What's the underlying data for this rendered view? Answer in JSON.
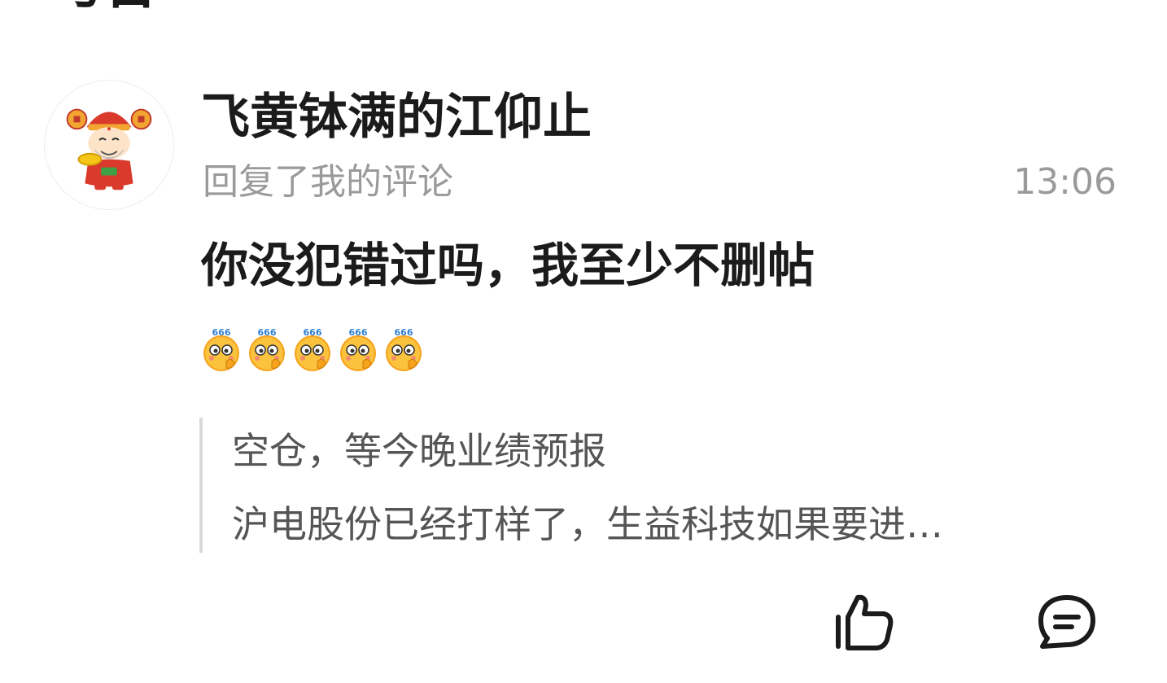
{
  "header": {
    "title": "与台"
  },
  "comment": {
    "avatar_icon": "god-of-wealth-avatar",
    "username": "飞黄钵满的江仰止",
    "action": "回复了我的评论",
    "time": "13:06",
    "reply_text": "你没犯错过吗，我至少不删帖",
    "emojis": [
      "666-emoji",
      "666-emoji",
      "666-emoji",
      "666-emoji",
      "666-emoji"
    ],
    "quoted": {
      "line1": "空仓，等今晚业绩预报",
      "line2": "沪电股份已经打样了，生益科技如果要进…"
    }
  },
  "actions": {
    "like_icon": "thumbs-up-icon",
    "comment_icon": "comment-bubble-icon"
  },
  "colors": {
    "text_primary": "#1b1b1b",
    "text_secondary": "#9a9a9a",
    "quote_text": "#555555",
    "quote_border": "#d9d9d9"
  }
}
